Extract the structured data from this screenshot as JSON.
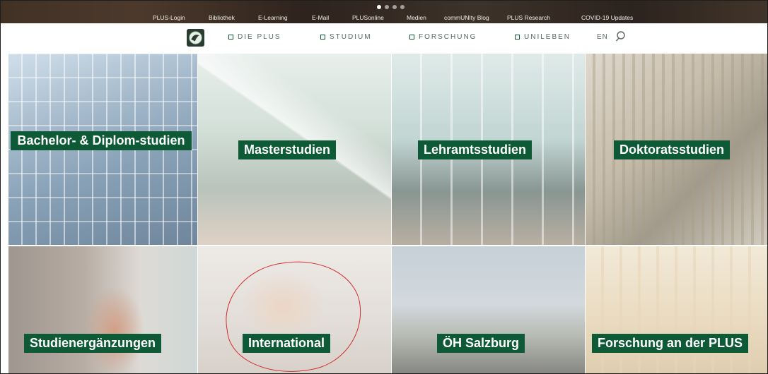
{
  "slider": {
    "dots": 4,
    "active_index": 0
  },
  "top_links": [
    "PLUS-Login",
    "Bibliothek",
    "E-Learning",
    "E-Mail",
    "PLUSonline",
    "Medien",
    "commUNIty Blog",
    "PLUS Research",
    "COVID-19 Updates"
  ],
  "nav": {
    "items": [
      "DIE PLUS",
      "STUDIUM",
      "FORSCHUNG",
      "UNILEBEN"
    ],
    "lang": "EN"
  },
  "tiles": [
    {
      "label": "Bachelor- & Diplom-studien"
    },
    {
      "label": "Masterstudien"
    },
    {
      "label": "Lehramtsstudien"
    },
    {
      "label": "Doktoratsstudien"
    },
    {
      "label": "Studienergänzungen"
    },
    {
      "label": "International"
    },
    {
      "label": "ÖH Salzburg"
    },
    {
      "label": "Forschung an der PLUS"
    }
  ],
  "colors": {
    "brand_green": "#0e5a37",
    "annotation_red": "#d42b2b"
  },
  "icons": {
    "search": "search-icon",
    "logo": "university-logo"
  }
}
